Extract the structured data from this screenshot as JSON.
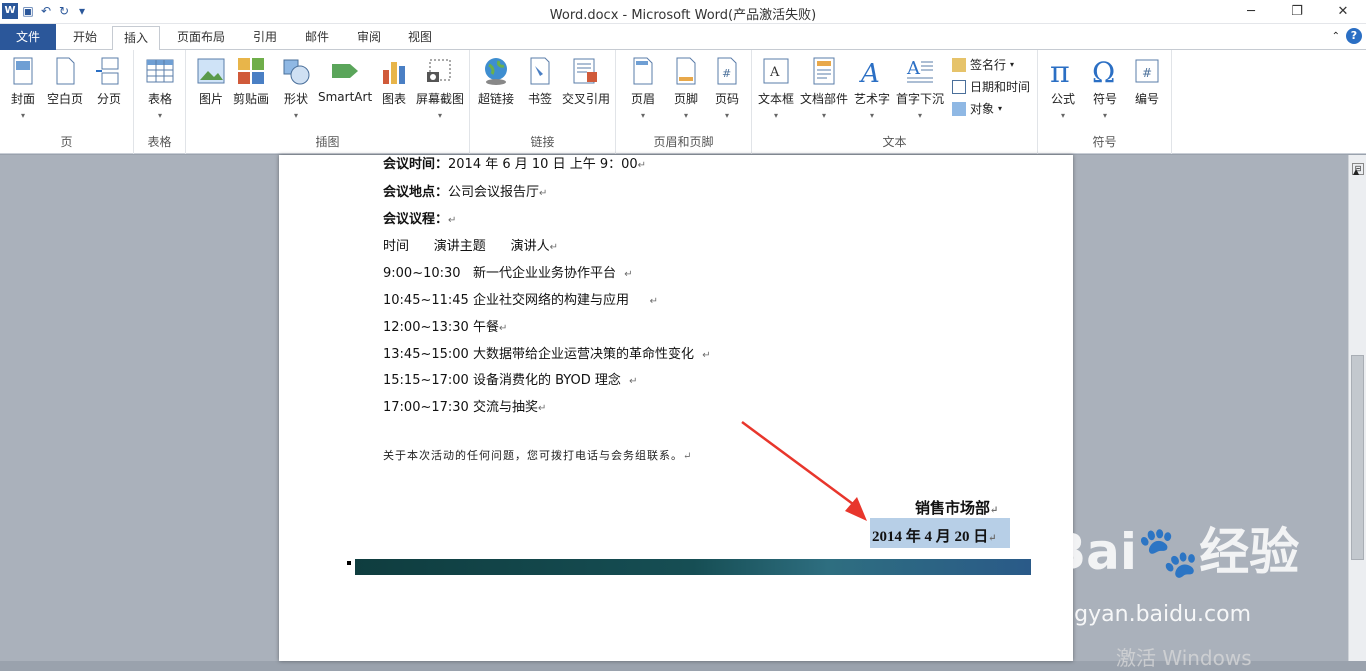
{
  "window": {
    "title": "Word.docx  -  Microsoft Word(产品激活失败)",
    "quick_access": [
      "word-logo",
      "save-icon",
      "undo-icon",
      "redo-icon",
      "customize-icon"
    ],
    "controls": [
      "─",
      "❐",
      "✕"
    ]
  },
  "tabs": [
    "文件",
    "开始",
    "插入",
    "页面布局",
    "引用",
    "邮件",
    "审阅",
    "视图"
  ],
  "active_tab": "插入",
  "groups": {
    "page": "页",
    "table": "表格",
    "illustrations": "插图",
    "links": "链接",
    "header_footer": "页眉和页脚",
    "text": "文本",
    "symbols": "符号"
  },
  "buttons": {
    "cover": "封面",
    "blank": "空白页",
    "break": "分页",
    "table": "表格",
    "picture": "图片",
    "clipart": "剪贴画",
    "shapes": "形状",
    "smartart": "SmartArt",
    "chart": "图表",
    "screenshot": "屏幕截图",
    "hyperlink": "超链接",
    "bookmark": "书签",
    "crossref": "交叉引用",
    "header": "页眉",
    "footer": "页脚",
    "pagenum": "页码",
    "textbox": "文本框",
    "quickparts": "文档部件",
    "wordart": "艺术字",
    "dropcap": "首字下沉",
    "signature": "签名行",
    "datetime": "日期和时间",
    "object": "对象",
    "equation": "公式",
    "symbol": "符号",
    "number": "编号"
  },
  "doc": {
    "l0_label": "会议时间：",
    "l0_text": "2014 年 6 月 10 日 上午 9：00",
    "l1_label": "会议地点：",
    "l1_text": "公司会议报告厅",
    "l2_label": "会议议程：",
    "l3": "时间      演讲主题      演讲人",
    "l4": "9:00~10:30   新一代企业业务协作平台",
    "l5": "10:45~11:45 企业社交网络的构建与应用",
    "l6": "12:00~13:30 午餐",
    "l7": "13:45~15:00 大数据带给企业运营决策的革命性变化",
    "l8": "15:15~17:00 设备消费化的 BYOD 理念",
    "l9": "17:00~17:30 交流与抽奖",
    "note": "关于本次活动的任何问题，您可拨打电话与会务组联系。",
    "dept": "销售市场部",
    "date": "2014 年 4 月 20 日",
    "para_mark": "↵"
  },
  "watermark": {
    "brand": "Bai",
    "brand2": "经验",
    "url": "jingyan.baidu.com",
    "activate": "激活 Windows"
  }
}
